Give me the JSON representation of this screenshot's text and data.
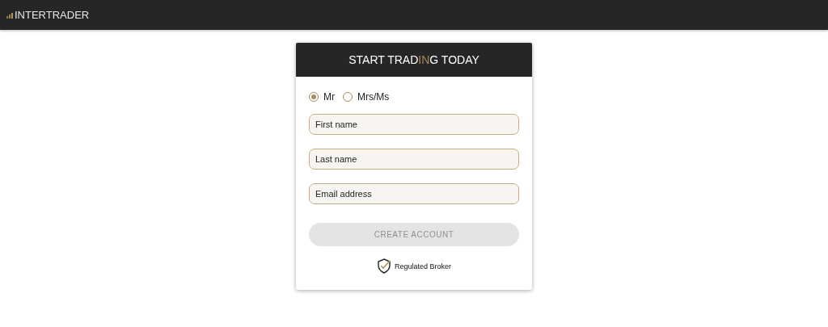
{
  "topbar": {
    "logo": "INTERTRADER"
  },
  "card": {
    "title_parts": [
      {
        "text": "START TRAD",
        "highlighted": false
      },
      {
        "text": "IN",
        "highlighted": true
      },
      {
        "text": "G TODAY",
        "highlighted": false
      }
    ],
    "salutations": [
      {
        "label": "Mr",
        "selected": true
      },
      {
        "label": "Mrs/Ms",
        "selected": false
      }
    ],
    "fields": [
      {
        "placeholder": "First name"
      },
      {
        "placeholder": "Last name"
      },
      {
        "placeholder": "Email address"
      }
    ],
    "submit": {
      "label": "CREATE ACCOUNT",
      "disabled": true
    },
    "badge": {
      "label": "Regulated Broker"
    }
  }
}
